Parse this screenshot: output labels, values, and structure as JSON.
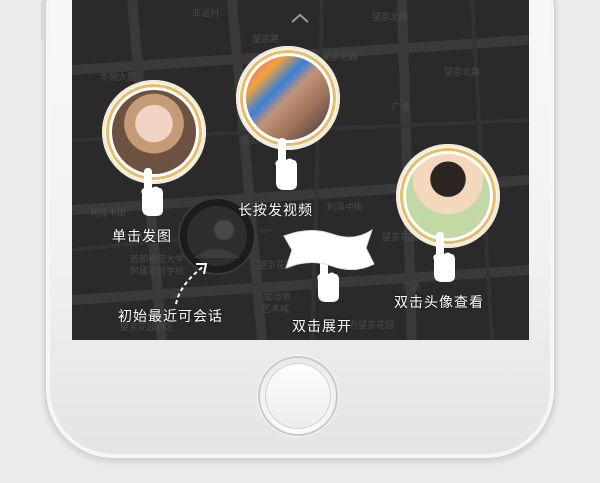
{
  "screen": {
    "map_labels": [
      "亚运村",
      "北京北路",
      "华苑大厦",
      "望京北路",
      "利泽中街",
      "首都师范大学",
      "附属实验学校",
      "望京花园",
      "艺术城",
      "望京北路",
      "广顺",
      "首都师",
      "求实",
      "利泽中街",
      "望京花园东区",
      "广场",
      "如诗意",
      "望京花园西区",
      "百万望京花园",
      "望京路"
    ],
    "gestures": {
      "single_tap": "单击发图",
      "long_press": "长按发视频",
      "double_tap_view": "双击头像查看",
      "recent_chat": "初始最近可会话",
      "double_tap_expand": "双击展开"
    },
    "banner_text": "双击展开"
  },
  "colors": {
    "screen_bg": "#282828",
    "ring": "#e7bd6a",
    "phone_body": "#f4f4f4"
  },
  "icons": [
    "chevron-up-icon",
    "hand-pointer-icon",
    "dashed-arrow-icon",
    "flag-banner-icon"
  ]
}
